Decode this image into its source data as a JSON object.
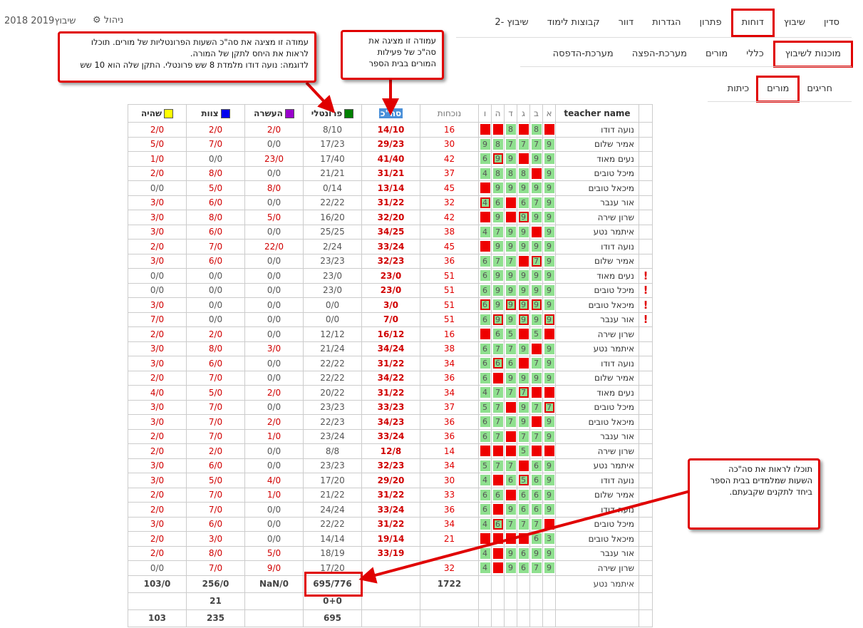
{
  "brand": "שיבוץ2019 2018",
  "admin_label": "ניהול",
  "nav1": [
    "סדין",
    "שיבוץ",
    "דוחות",
    "פתרון",
    "הגדרות",
    "דוור",
    "קבוצות לימוד",
    "שיבוץ -2"
  ],
  "nav2": [
    "מוכנות לשיבוץ",
    "כללי",
    "מורים",
    "מערכת-הפצה",
    "מערכת-הדפסה"
  ],
  "nav3": [
    "חריגים",
    "מורים",
    "כיתות"
  ],
  "headers": {
    "name": "teacher name",
    "days": [
      "א",
      "ב",
      "ג",
      "ד",
      "ה",
      "ו"
    ],
    "attendance": "נוכחות",
    "total": "סה\"כ",
    "frontal": "פרונטלי",
    "enrichment": "העשרה",
    "staff": "צוות",
    "stay": "שהיה"
  },
  "colors": {
    "frontal": "#008000",
    "enrichment": "#9900cc",
    "staff": "#0000ee",
    "stay": "#ffff00"
  },
  "rows": [
    {
      "excl": false,
      "name": "נועה דודו",
      "days": [
        "r",
        "g8",
        "r",
        "g8",
        "r",
        "r"
      ],
      "att": "16",
      "total": "14/10",
      "frontal": "8/10",
      "enrich": "2/0",
      "staff": "2/0",
      "stay": "2/0"
    },
    {
      "excl": false,
      "name": "אמיר שלום",
      "days": [
        "g9",
        "g7",
        "g7",
        "g7",
        "g8",
        "g9"
      ],
      "att": "30",
      "total": "29/23",
      "frontal": "17/23",
      "enrich": "0/0",
      "staff": "7/0",
      "stay": "5/0"
    },
    {
      "excl": false,
      "name": "נעים מאוד",
      "days": [
        "g9",
        "g9",
        "r",
        "g9",
        "o9",
        "g6"
      ],
      "att": "42",
      "total": "41/40",
      "frontal": "17/40",
      "enrich": "23/0",
      "staff": "0/0",
      "stay": "1/0"
    },
    {
      "excl": false,
      "name": "מיכל טובים",
      "days": [
        "g9",
        "r",
        "g8",
        "g8",
        "g8",
        "g4"
      ],
      "att": "37",
      "total": "31/21",
      "frontal": "21/21",
      "enrich": "0/0",
      "staff": "8/0",
      "stay": "2/0"
    },
    {
      "excl": false,
      "name": "מיכאל טובים",
      "days": [
        "g9",
        "g9",
        "g9",
        "g9",
        "g9",
        "r"
      ],
      "att": "45",
      "total": "13/14",
      "frontal": "0/14",
      "enrich": "8/0",
      "staff": "5/0",
      "stay": "0/0"
    },
    {
      "excl": false,
      "name": "אור ענבר",
      "days": [
        "g9",
        "g7",
        "g6",
        "r",
        "g6",
        "o4"
      ],
      "att": "32",
      "total": "31/22",
      "frontal": "22/22",
      "enrich": "0/0",
      "staff": "6/0",
      "stay": "3/0"
    },
    {
      "excl": false,
      "name": "שרון שירה",
      "days": [
        "g9",
        "g9",
        "o9",
        "r",
        "g9",
        "r"
      ],
      "att": "42",
      "total": "32/20",
      "frontal": "16/20",
      "enrich": "5/0",
      "staff": "8/0",
      "stay": "3/0"
    },
    {
      "excl": false,
      "name": "איתמר נטע",
      "days": [
        "g9",
        "r",
        "g9",
        "g9",
        "g7",
        "g4"
      ],
      "att": "38",
      "total": "34/25",
      "frontal": "25/25",
      "enrich": "0/0",
      "staff": "6/0",
      "stay": "3/0"
    },
    {
      "excl": false,
      "name": "נועה דודו",
      "days": [
        "g9",
        "g9",
        "g9",
        "g9",
        "g9",
        "r"
      ],
      "att": "45",
      "total": "33/24",
      "frontal": "2/24",
      "enrich": "22/0",
      "staff": "7/0",
      "stay": "2/0"
    },
    {
      "excl": false,
      "name": "אמיר שלום",
      "days": [
        "g9",
        "o7",
        "r",
        "g7",
        "g7",
        "g6"
      ],
      "att": "36",
      "total": "32/23",
      "frontal": "23/23",
      "enrich": "0/0",
      "staff": "6/0",
      "stay": "3/0"
    },
    {
      "excl": true,
      "name": "נעים מאוד",
      "days": [
        "g9",
        "g9",
        "g9",
        "g9",
        "g9",
        "g6"
      ],
      "att": "51",
      "total": "23/0",
      "frontal": "23/0",
      "enrich": "0/0",
      "staff": "0/0",
      "stay": "0/0"
    },
    {
      "excl": true,
      "name": "מיכל טובים",
      "days": [
        "g9",
        "g9",
        "g9",
        "g9",
        "g9",
        "g6"
      ],
      "att": "51",
      "total": "23/0",
      "frontal": "23/0",
      "enrich": "0/0",
      "staff": "0/0",
      "stay": "0/0"
    },
    {
      "excl": true,
      "name": "מיכאל טובים",
      "days": [
        "g9",
        "o9",
        "o9",
        "o9",
        "g9",
        "o6"
      ],
      "att": "51",
      "total": "3/0",
      "frontal": "0/0",
      "enrich": "0/0",
      "staff": "0/0",
      "stay": "3/0"
    },
    {
      "excl": true,
      "name": "אור ענבר",
      "days": [
        "o9",
        "g9",
        "o9",
        "g9",
        "o9",
        "g6"
      ],
      "att": "51",
      "total": "7/0",
      "frontal": "0/0",
      "enrich": "0/0",
      "staff": "0/0",
      "stay": "7/0"
    },
    {
      "excl": false,
      "name": "שרון שירה",
      "days": [
        "r",
        "g5",
        "r",
        "g5",
        "g6",
        "r"
      ],
      "att": "16",
      "total": "16/12",
      "frontal": "12/12",
      "enrich": "0/0",
      "staff": "2/0",
      "stay": "2/0"
    },
    {
      "excl": false,
      "name": "איתמר נטע",
      "days": [
        "g9",
        "r",
        "g9",
        "g7",
        "g7",
        "g6"
      ],
      "att": "38",
      "total": "34/24",
      "frontal": "21/24",
      "enrich": "3/0",
      "staff": "8/0",
      "stay": "3/0"
    },
    {
      "excl": false,
      "name": "נועה דודו",
      "days": [
        "g9",
        "g7",
        "r",
        "g6",
        "o6",
        "g6"
      ],
      "att": "34",
      "total": "31/22",
      "frontal": "22/22",
      "enrich": "0/0",
      "staff": "6/0",
      "stay": "3/0"
    },
    {
      "excl": false,
      "name": "אמיר שלום",
      "days": [
        "g9",
        "g9",
        "g9",
        "g9",
        "r",
        "g6"
      ],
      "att": "36",
      "total": "34/22",
      "frontal": "22/22",
      "enrich": "0/0",
      "staff": "7/0",
      "stay": "2/0"
    },
    {
      "excl": false,
      "name": "נעים מאוד",
      "days": [
        "r",
        "r",
        "o7",
        "g7",
        "g7",
        "g4"
      ],
      "att": "34",
      "total": "31/22",
      "frontal": "20/22",
      "enrich": "2/0",
      "staff": "5/0",
      "stay": "4/0"
    },
    {
      "excl": false,
      "name": "מיכל טובים",
      "days": [
        "o7",
        "g7",
        "g9",
        "r",
        "g7",
        "g5"
      ],
      "att": "37",
      "total": "33/23",
      "frontal": "23/23",
      "enrich": "0/0",
      "staff": "7/0",
      "stay": "3/0"
    },
    {
      "excl": false,
      "name": "מיכאל טובים",
      "days": [
        "g9",
        "r",
        "g9",
        "g7",
        "g7",
        "g6"
      ],
      "att": "36",
      "total": "34/23",
      "frontal": "22/23",
      "enrich": "2/0",
      "staff": "7/0",
      "stay": "3/0"
    },
    {
      "excl": false,
      "name": "אור ענבר",
      "days": [
        "g9",
        "g7",
        "g7",
        "r",
        "g7",
        "g6"
      ],
      "att": "36",
      "total": "33/24",
      "frontal": "23/24",
      "enrich": "1/0",
      "staff": "7/0",
      "stay": "2/0"
    },
    {
      "excl": false,
      "name": "שרון שירה",
      "days": [
        "r",
        "r",
        "g5",
        "r",
        "r",
        "r"
      ],
      "att": "14",
      "total": "12/8",
      "frontal": "8/8",
      "enrich": "0/0",
      "staff": "2/0",
      "stay": "2/0"
    },
    {
      "excl": false,
      "name": "איתמר נטע",
      "days": [
        "g9",
        "g6",
        "r",
        "g7",
        "g7",
        "g5"
      ],
      "att": "34",
      "total": "32/23",
      "frontal": "23/23",
      "enrich": "0/0",
      "staff": "6/0",
      "stay": "3/0"
    },
    {
      "excl": false,
      "name": "נועה דודו",
      "days": [
        "g9",
        "g6",
        "o5",
        "g6",
        "r",
        "g4"
      ],
      "att": "30",
      "total": "29/20",
      "frontal": "17/20",
      "enrich": "4/0",
      "staff": "5/0",
      "stay": "3/0"
    },
    {
      "excl": false,
      "name": "אמיר שלום",
      "days": [
        "g9",
        "g6",
        "g6",
        "r",
        "g6",
        "g6"
      ],
      "att": "33",
      "total": "31/22",
      "frontal": "21/22",
      "enrich": "1/0",
      "staff": "7/0",
      "stay": "2/0"
    },
    {
      "excl": false,
      "name": "נועה דודו",
      "days": [
        "g9",
        "g6",
        "g6",
        "g9",
        "r",
        "g6"
      ],
      "att": "36",
      "total": "33/24",
      "frontal": "24/24",
      "enrich": "0/0",
      "staff": "7/0",
      "stay": "2/0"
    },
    {
      "excl": false,
      "name": "מיכל טובים",
      "days": [
        "r",
        "g7",
        "g7",
        "g7",
        "o6",
        "g4"
      ],
      "att": "34",
      "total": "31/22",
      "frontal": "22/22",
      "enrich": "0/0",
      "staff": "6/0",
      "stay": "3/0"
    },
    {
      "excl": false,
      "name": "מיכאל טובים",
      "days": [
        "g3",
        "g6",
        "r",
        "r",
        "r",
        "r"
      ],
      "att": "21",
      "total": "19/14",
      "frontal": "14/14",
      "enrich": "0/0",
      "staff": "3/0",
      "stay": "2/0"
    },
    {
      "excl": false,
      "name": "אור ענבר",
      "days": [
        "g9",
        "g9",
        "g6",
        "g9",
        "r",
        "g4"
      ],
      "att": "",
      "total": "33/19",
      "frontal": "18/19",
      "enrich": "5/0",
      "staff": "8/0",
      "stay": "2/0"
    },
    {
      "excl": false,
      "name": "שרון שירה",
      "days": [
        "g9",
        "g7",
        "g6",
        "g9",
        "r",
        "g4"
      ],
      "att": "32",
      "total": "",
      "frontal": "17/20",
      "enrich": "9/0",
      "staff": "7/0",
      "stay": "0/0"
    }
  ],
  "summary1": {
    "name": "איתמר נטע",
    "att": "1722",
    "frontal": "695/776",
    "enrich": "NaN/0",
    "staff": "256/0",
    "stay": "103/0"
  },
  "summary2": {
    "frontal": "0+0",
    "staff": "21"
  },
  "summary3": {
    "frontal": "695",
    "staff": "235",
    "stay": "103"
  },
  "callout1": {
    "line1": "עמודה זו מציגה את סה\"כ השעות הפרונטליות של מורים. תוכלו",
    "line2": "לראות את היחס לתקן של המורה.",
    "line3": "לדוגמה: נועה דודו מלמדת 8 שש פרונטלי. התקן שלה הוא 10 שש"
  },
  "callout2": {
    "line1": "עמודה זו מציגה את",
    "line2": "סה\"כ של פעילות",
    "line3": "המורים בבית הספר"
  },
  "callout3": {
    "line1": "תוכלו לראות את סה\"כה",
    "line2": "השעות שמלמדים בבית הספר",
    "line3": "ביחד לתקנים שקבעתם."
  }
}
